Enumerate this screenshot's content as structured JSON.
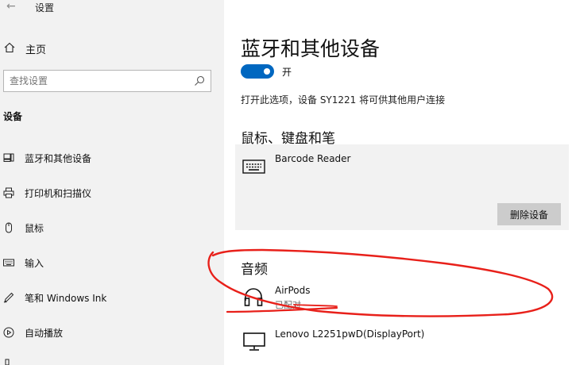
{
  "titlebar": {
    "back_glyph": "←",
    "app_title": "设置"
  },
  "sidebar": {
    "home_label": "主页",
    "search_placeholder": "查找设置",
    "section_header": "设备",
    "items": [
      {
        "label": "蓝牙和其他设备",
        "icon": "bluetooth-devices-icon"
      },
      {
        "label": "打印机和扫描仪",
        "icon": "printer-icon"
      },
      {
        "label": "鼠标",
        "icon": "mouse-icon"
      },
      {
        "label": "输入",
        "icon": "keyboard-icon"
      },
      {
        "label": "笔和 Windows Ink",
        "icon": "pen-icon"
      },
      {
        "label": "自动播放",
        "icon": "autoplay-icon"
      }
    ]
  },
  "main": {
    "title": "蓝牙和其他设备",
    "toggle_label": "开",
    "toggle_on": true,
    "description": "打开此选项，设备 SY1221 将可供其他用户连接",
    "sections": {
      "mouse_keyboard_pen": "鼠标、键盘和笔",
      "audio": "音频"
    },
    "devices": {
      "barcode_reader": {
        "name": "Barcode Reader",
        "icon": "keyboard-icon",
        "remove_label": "删除设备"
      },
      "airpods": {
        "name": "AirPods",
        "status": "已配对",
        "icon": "headphones-icon"
      },
      "monitor": {
        "name": "Lenovo L2251pwD(DisplayPort)",
        "icon": "monitor-icon"
      }
    }
  },
  "colors": {
    "accent": "#0067c0",
    "annotation": "#e8201a",
    "sidebar_bg": "#f2f2f2"
  }
}
